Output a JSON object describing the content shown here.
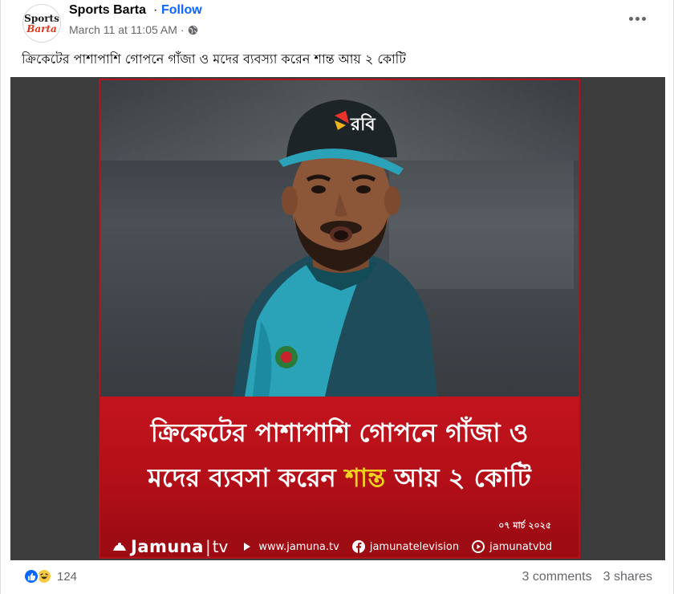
{
  "post": {
    "page_name": "Sports Barta",
    "separator": "·",
    "follow_label": "Follow",
    "timestamp": "March 11 at 11:05 AM",
    "meta_separator": "·",
    "privacy_icon": "globe-icon",
    "caption": "ক্রিকেটের পাশাপাশি গোপনে গাঁজা ও মদের ব্যবস্যা করেন শান্ত আয় ২ কোটি"
  },
  "avatar": {
    "line1": "Sports",
    "line2": "Barta"
  },
  "media": {
    "cap_logo_text": "রবি",
    "headline_line1": "ক্রিকেটের পাশাপাশি গোপনে গাঁজা ও",
    "headline_line2_pre": "মদের ব্যবসা করেন ",
    "headline_line2_highlight": "শান্ত",
    "headline_line2_post": " আয় ২ কোটি",
    "date_stamp": "০৭ মার্চ ২০২৫",
    "brand_word": "Jamuna",
    "brand_bar": "|",
    "brand_tv": "tv",
    "website": "www.jamuna.tv",
    "facebook": "jamunatelevision",
    "youtube": "jamunatvbd",
    "colors": {
      "band": "#c3141e",
      "highlight": "#f2d21c",
      "footer": "#9d0b13"
    }
  },
  "stats": {
    "reaction_count": "124",
    "comments": "3 comments",
    "shares": "3 shares",
    "reaction_icons": [
      "like-icon",
      "haha-icon"
    ]
  }
}
